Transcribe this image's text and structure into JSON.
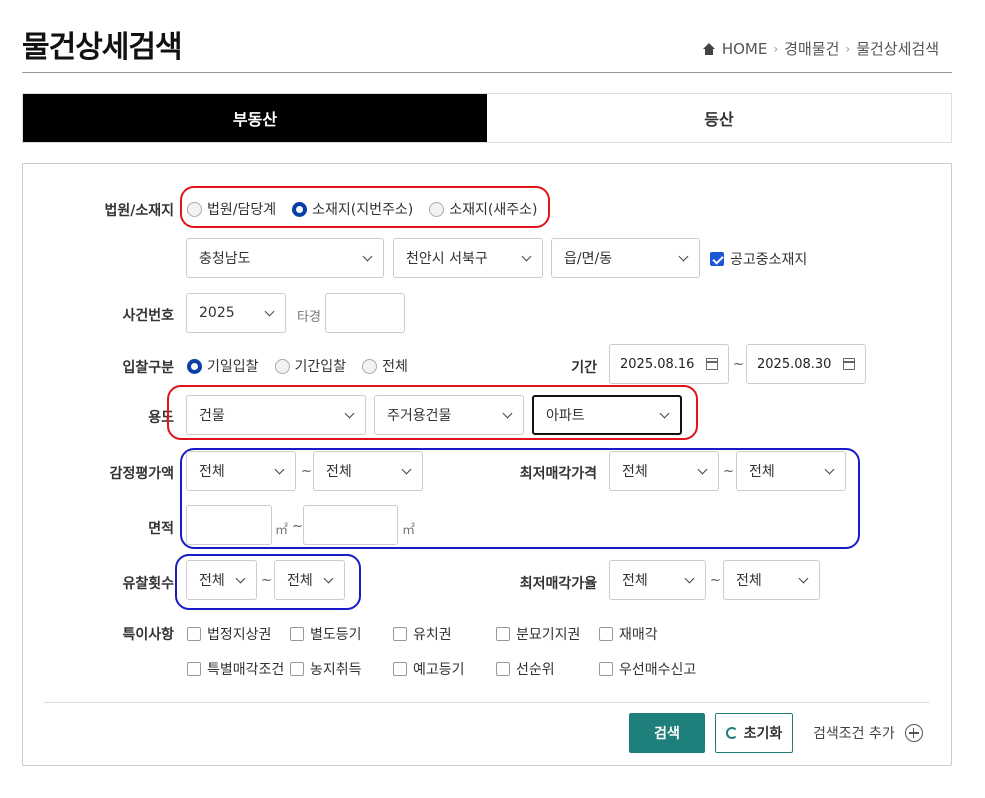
{
  "header": {
    "title": "물건상세검색",
    "breadcrumb": [
      "HOME",
      "경매물건",
      "물건상세검색"
    ]
  },
  "tabs": [
    {
      "label": "부동산",
      "active": true
    },
    {
      "label": "등산",
      "active": false
    }
  ],
  "form": {
    "court_location": {
      "label": "법원/소재지",
      "options": [
        "법원/담당계",
        "소재지(지번주소)",
        "소재지(새주소)"
      ],
      "selected": "소재지(지번주소)",
      "province": "충청남도",
      "city": "천안시 서북구",
      "town": "읍/면/동",
      "notice_checkbox": {
        "label": "공고중소재지",
        "checked": true
      }
    },
    "case_number": {
      "label": "사건번호",
      "year": "2025",
      "suffix_label": "타경",
      "value": ""
    },
    "bid_type": {
      "label": "입찰구분",
      "options": [
        "기일입찰",
        "기간입찰",
        "전체"
      ],
      "selected": "기일입찰",
      "period_label": "기간",
      "date_from": "2025.08.16",
      "date_to": "2025.08.30",
      "tilde": "~"
    },
    "usage": {
      "label": "용도",
      "level1": "건물",
      "level2": "주거용건물",
      "level3": "아파트"
    },
    "appraisal": {
      "label": "감정평가액",
      "from": "전체",
      "to": "전체"
    },
    "min_price": {
      "label": "최저매각가격",
      "from": "전체",
      "to": "전체"
    },
    "area": {
      "label": "면적",
      "unit": "㎡"
    },
    "fail_count": {
      "label": "유찰횟수",
      "from": "전체",
      "to": "전체"
    },
    "min_rate": {
      "label": "최저매각가율",
      "from": "전체",
      "to": "전체"
    },
    "special": {
      "label": "특이사항",
      "row1": [
        "법정지상권",
        "별도등기",
        "유치권",
        "분묘기지권",
        "재매각"
      ],
      "row2": [
        "특별매각조건",
        "농지취득",
        "예고등기",
        "선순위",
        "우선매수신고"
      ]
    }
  },
  "actions": {
    "search": "검색",
    "reset": "초기화",
    "add_condition": "검색조건 추가"
  },
  "colors": {
    "accent": "#1f7f7a",
    "highlight_red": "#e0141b",
    "highlight_blue": "#1a1ac8",
    "radio_selected": "#0a3fa8"
  }
}
